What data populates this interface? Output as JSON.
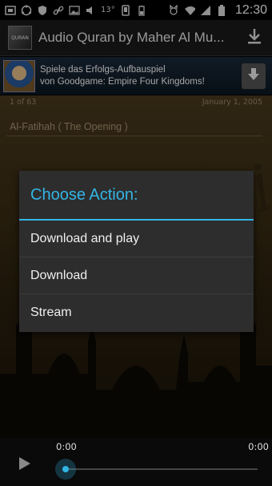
{
  "status_bar": {
    "icons": [
      "carrier-icon",
      "ubuntu-icon",
      "shield-icon",
      "link-icon",
      "image-icon",
      "volume-icon",
      "temperature-icon",
      "phone-icon",
      "battery-small-icon",
      "cat-icon",
      "wifi-icon",
      "signal-icon",
      "battery-icon"
    ],
    "temperature": "13°",
    "time": "12:30"
  },
  "action_bar": {
    "title": "Audio Quran by Maher Al Mu...",
    "icon_label": "QURAN"
  },
  "ad": {
    "line1": "Spiele das Erfolgs-Aufbauspiel",
    "line2": "von Goodgame: Empire Four Kingdoms!"
  },
  "content": {
    "counter": "1 of 63",
    "date": "January 1, 2005",
    "surah_title": "Al-Fatihah ( The Opening )"
  },
  "dialog": {
    "title": "Choose Action:",
    "items": [
      "Download and play",
      "Download",
      "Stream"
    ]
  },
  "player": {
    "current_time": "0:00",
    "total_time": "0:00",
    "progress": 0
  },
  "colors": {
    "accent": "#33b5e5",
    "dialog_bg": "#2d2d2d"
  }
}
